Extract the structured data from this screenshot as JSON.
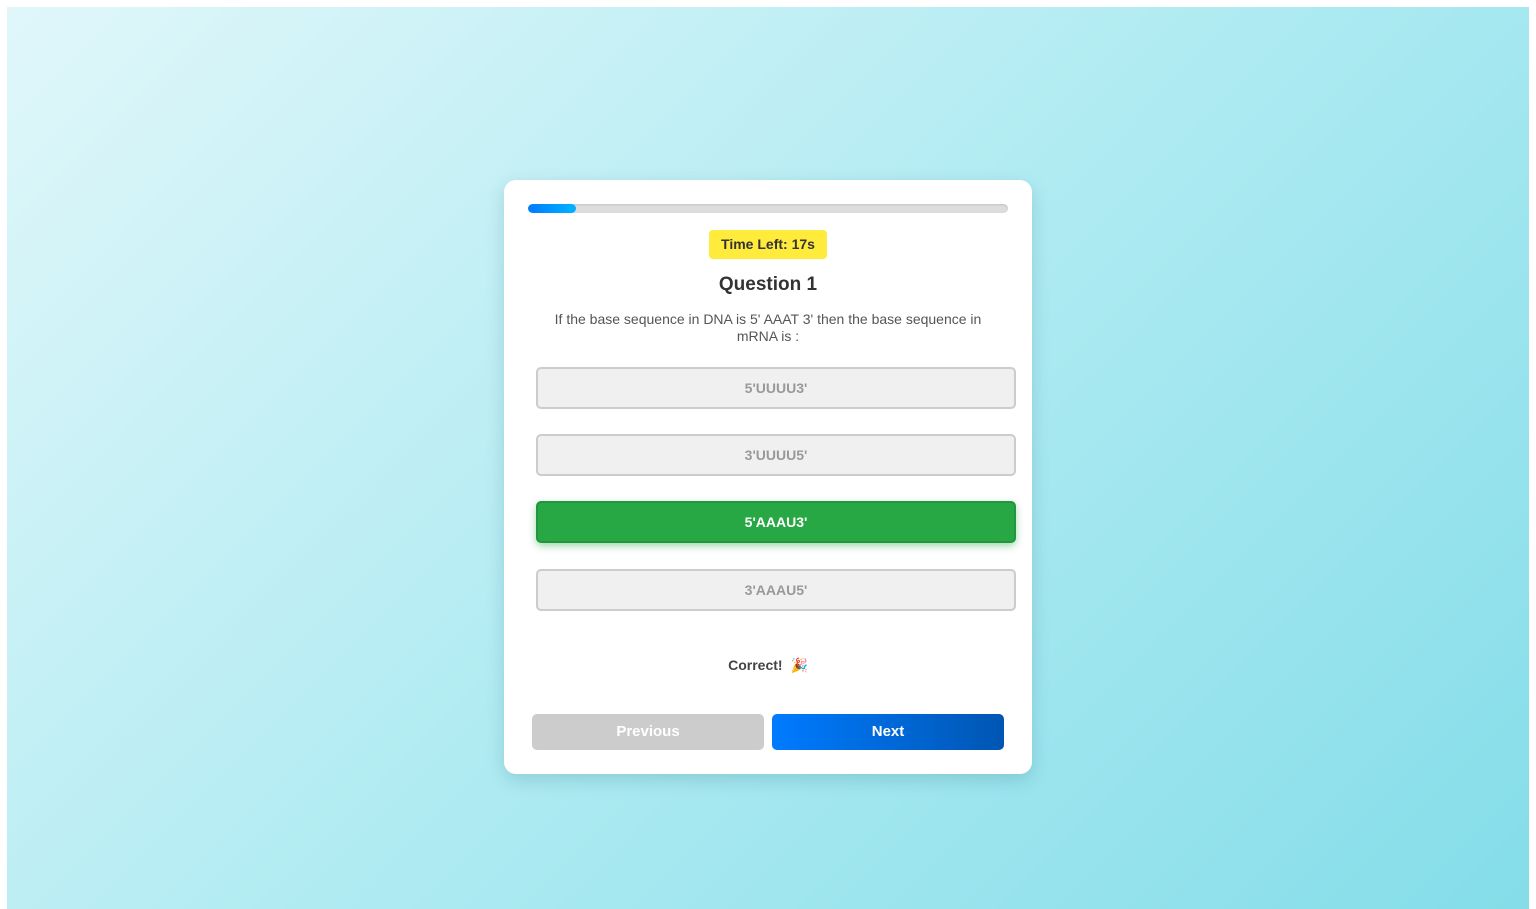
{
  "progress": {
    "value_percent": 10,
    "fill_colors": [
      "#007bff",
      "#00b4ff"
    ]
  },
  "timer": {
    "text": "Time Left: 17s",
    "color": "#ffeb3b"
  },
  "question": {
    "title": "Question 1",
    "text": "If the base sequence in DNA is 5' AAAT 3' then the base sequence in mRNA is :"
  },
  "options": [
    {
      "label": "5'UUUU3'",
      "state": "disabled"
    },
    {
      "label": "3'UUUU5'",
      "state": "disabled"
    },
    {
      "label": "5'AAAU3'",
      "state": "correct"
    },
    {
      "label": "3'AAAU5'",
      "state": "disabled"
    }
  ],
  "feedback": {
    "text": "Correct!",
    "icon": "party-popper-icon"
  },
  "navigation": {
    "previous_label": "Previous",
    "next_label": "Next"
  },
  "colors": {
    "correct": "#28a745",
    "primary": "#007bff",
    "disabled": "#cccccc"
  }
}
